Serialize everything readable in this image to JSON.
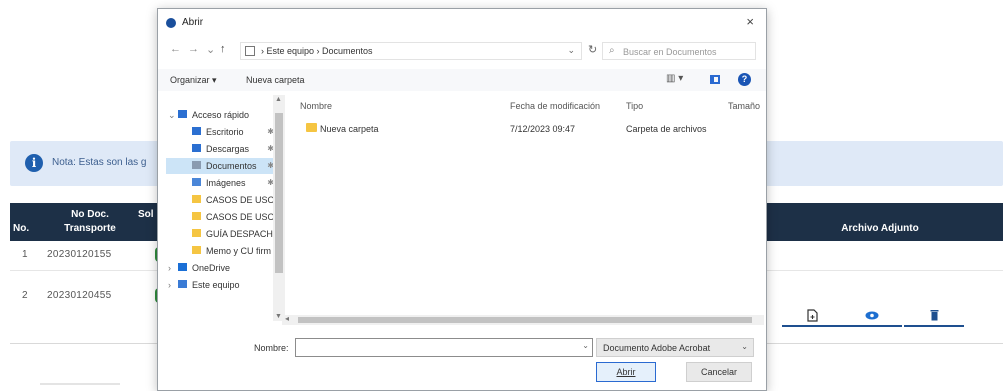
{
  "page": {
    "note_text": "Nota: Estas son las g",
    "table": {
      "headers": {
        "no": "No.",
        "doc": "No Doc. Transporte",
        "sol": "Sol F",
        "attach": "Archivo Adjunto"
      },
      "rows": [
        {
          "no": "1",
          "doc": "20230120155"
        },
        {
          "no": "2",
          "doc": "20230120455"
        }
      ]
    },
    "status_color": "#2f8c3d",
    "header_color": "#1d3047",
    "accent": "#1e4f8f"
  },
  "dialog": {
    "title": "Abrir",
    "close": "×",
    "nav": {
      "back": "←",
      "forward": "→",
      "recent": "⌄",
      "up": "↑"
    },
    "address": "› Este equipo › Documentos",
    "address_chevron": "⌄",
    "refresh": "↻",
    "search_placeholder": "Buscar en Documentos",
    "toolbar": {
      "organize": "Organizar ▾",
      "new_folder": "Nueva carpeta",
      "view": "▥ ▾",
      "help": "?"
    },
    "tree": [
      {
        "label": "Acceso rápido",
        "expand": "⌄",
        "icon": "star-icon",
        "color": "#2b6fd1"
      },
      {
        "label": "Escritorio",
        "pin": "✱",
        "icon": "desktop-icon",
        "color": "#2b6fd1"
      },
      {
        "label": "Descargas",
        "pin": "✱",
        "icon": "download-icon",
        "color": "#2b6fd1"
      },
      {
        "label": "Documentos",
        "pin": "✱",
        "icon": "documents-icon",
        "color": "#8a9bb0",
        "selected": true
      },
      {
        "label": "Imágenes",
        "pin": "✱",
        "icon": "images-icon",
        "color": "#4a86d8"
      },
      {
        "label": "CASOS DE USO",
        "icon": "folder-icon",
        "color": "#f5c542"
      },
      {
        "label": "CASOS DE USO",
        "icon": "folder-icon",
        "color": "#f5c542"
      },
      {
        "label": "GUÍA DESPACHO",
        "icon": "folder-icon",
        "color": "#f5c542"
      },
      {
        "label": "Memo y CU firm",
        "icon": "folder-icon",
        "color": "#f5c542"
      },
      {
        "label": "OneDrive",
        "expand": "›",
        "icon": "cloud-icon",
        "color": "#1a6fd6"
      },
      {
        "label": "Este equipo",
        "expand": "›",
        "icon": "computer-icon",
        "color": "#3a7bd5"
      }
    ],
    "columns": {
      "name": "Nombre",
      "date": "Fecha de modificación",
      "type": "Tipo",
      "size": "Tamaño"
    },
    "files": [
      {
        "name": "Nueva carpeta",
        "date": "7/12/2023 09:47",
        "type": "Carpeta de archivos"
      }
    ],
    "filename_label": "Nombre:",
    "filename_value": "",
    "file_type": "Documento Adobe Acrobat",
    "open_label": "Abrir",
    "cancel_label": "Cancelar"
  }
}
